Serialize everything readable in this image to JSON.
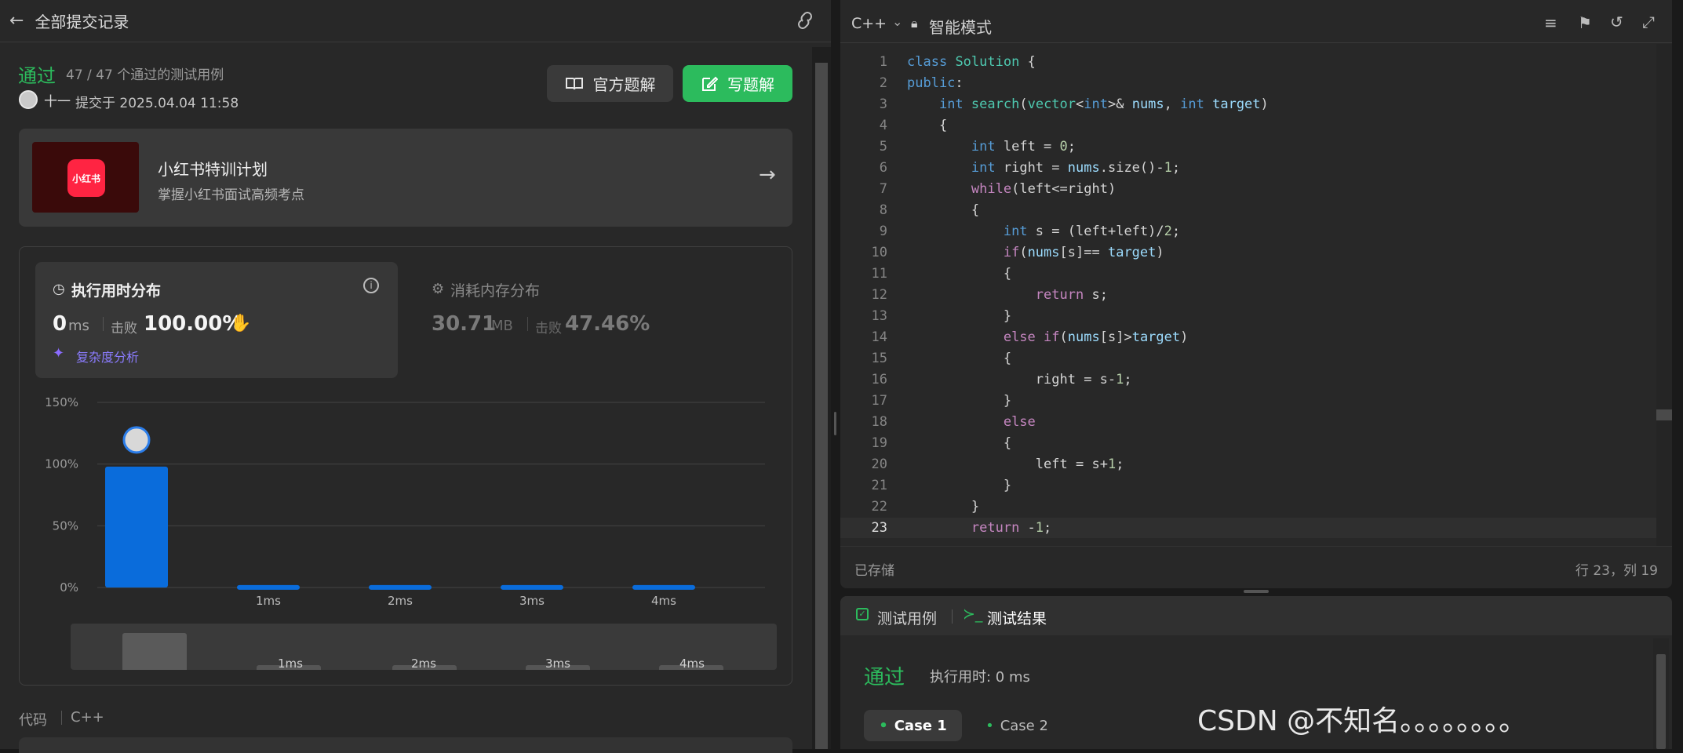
{
  "left": {
    "back_icon": "arrow-left-icon",
    "header_title": "全部提交记录",
    "share_icon": "link-icon",
    "status": "通过",
    "status_color": "#2cbb5d",
    "testcases": "47 / 47 个通过的测试用例",
    "author": "十一",
    "submitted": "提交于 2025.04.04 11:58",
    "official_btn": "官方题解",
    "write_btn": "写题解",
    "promo": {
      "logo_text": "小红书",
      "title": "小红书特训计划",
      "subtitle": "掌握小红书面试高频考点",
      "arrow_icon": "arrow-right-icon"
    },
    "runtime": {
      "title": "执行用时分布",
      "value": "0",
      "unit": "ms",
      "beats_label": "击败",
      "beats": "100.00%",
      "analysis": "复杂度分析"
    },
    "memory": {
      "title": "消耗内存分布",
      "value": "30.71",
      "unit": "MB",
      "beats_label": "击败",
      "beats": "47.46%"
    },
    "chart_data": {
      "type": "bar",
      "categories": [
        "",
        "1ms",
        "2ms",
        "3ms",
        "4ms"
      ],
      "values": [
        98,
        2,
        2,
        2,
        2
      ],
      "y_ticks": [
        "150%",
        "100%",
        "50%",
        "0%"
      ],
      "ylim": [
        0,
        150
      ],
      "highlight_index": 0,
      "bar_color": "#0a6cdb",
      "grid": true
    },
    "minimap_labels": [
      "1ms",
      "2ms",
      "3ms",
      "4ms"
    ],
    "code_label": "代码",
    "code_lang": "C++"
  },
  "editor": {
    "language": "C++",
    "mode": "智能模式",
    "status_saved": "已存储",
    "cursor": "行 23，列 19",
    "lines": [
      {
        "n": "1",
        "code": "class Solution {"
      },
      {
        "n": "2",
        "code": "public:"
      },
      {
        "n": "3",
        "code": "    int search(vector<int>& nums, int target)"
      },
      {
        "n": "4",
        "code": "    {"
      },
      {
        "n": "5",
        "code": "        int left = 0;"
      },
      {
        "n": "6",
        "code": "        int right = nums.size()-1;"
      },
      {
        "n": "7",
        "code": "        while(left<=right)"
      },
      {
        "n": "8",
        "code": "        {"
      },
      {
        "n": "9",
        "code": "            int s = (left+left)/2;"
      },
      {
        "n": "10",
        "code": "            if(nums[s]== target)"
      },
      {
        "n": "11",
        "code": "            {"
      },
      {
        "n": "12",
        "code": "                return s;"
      },
      {
        "n": "13",
        "code": "            }"
      },
      {
        "n": "14",
        "code": "            else if(nums[s]>target)"
      },
      {
        "n": "15",
        "code": "            {"
      },
      {
        "n": "16",
        "code": "                right = s-1;"
      },
      {
        "n": "17",
        "code": "            }"
      },
      {
        "n": "18",
        "code": "            else"
      },
      {
        "n": "19",
        "code": "            {"
      },
      {
        "n": "20",
        "code": "                left = s+1;"
      },
      {
        "n": "21",
        "code": "            }"
      },
      {
        "n": "22",
        "code": "        }"
      },
      {
        "n": "23",
        "code": "        return -1;"
      }
    ]
  },
  "result": {
    "tab1": "测试用例",
    "tab2": "测试结果",
    "status": "通过",
    "runtime": "执行用时: 0 ms",
    "case1": "Case 1",
    "case2": "Case 2"
  },
  "watermark": "CSDN @不知名。。。。。。。。"
}
